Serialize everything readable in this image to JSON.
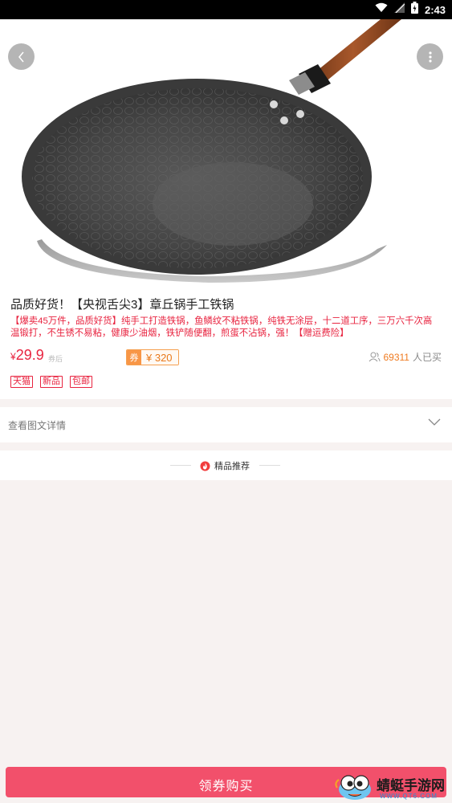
{
  "status_bar": {
    "time": "2:43"
  },
  "product": {
    "title": "品质好货！【央视舌尖3】章丘锅手工铁锅",
    "description": "【爆卖45万件，品质好货】纯手工打造铁锅，鱼鳞纹不粘铁锅，纯铁无涂层，十二道工序，三万六千次高温锻打，不生锈不易粘，健康少油烟，铁铲随便翻，煎蛋不沾锅，强！【赠运费险】",
    "price_symbol": "¥",
    "price": "29.9",
    "price_note": "券后",
    "coupon_tag": "券",
    "coupon_value": "¥ 320",
    "buyers_count": "69311",
    "buyers_suffix": "人已买",
    "badges": [
      "天猫",
      "新品",
      "包邮"
    ]
  },
  "detail": {
    "label": "查看图文详情"
  },
  "recommend": {
    "label": "精品推荐"
  },
  "buy_button": {
    "label": "领券购买"
  },
  "watermark": {
    "title": "蜻蜓手游网",
    "domain": "WWW.QT6.COM"
  },
  "colors": {
    "accent": "#e8233f",
    "buy_bar": "#f2506b",
    "coupon": "#f89646",
    "buyers_num": "#ef7a1f"
  },
  "icons": [
    "wifi-icon",
    "signal-icon",
    "battery-icon",
    "back-arrow-icon",
    "more-vertical-icon",
    "user-outline-icon",
    "chevron-down-icon",
    "flame-icon"
  ]
}
